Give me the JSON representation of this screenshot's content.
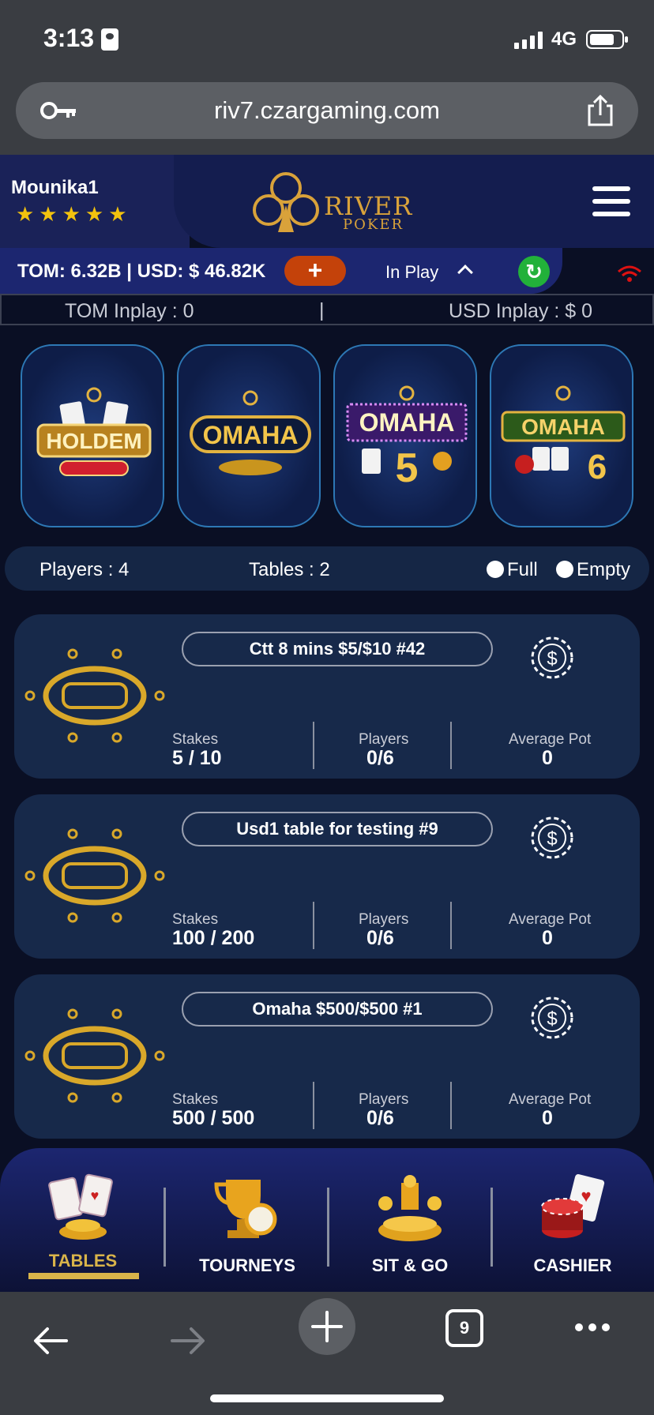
{
  "status_bar": {
    "time": "3:13",
    "network": "4G"
  },
  "browser": {
    "url": "riv7.czargaming.com",
    "tab_count": "9"
  },
  "header": {
    "username": "Mounika1",
    "stars": "★★★★★",
    "logo_text_1": "RIVER",
    "logo_text_2": "POKER",
    "balance": "TOM: 6.32B | USD: $ 46.82K",
    "add_label": "+",
    "inplay_label": "In Play",
    "refresh_label": "↻"
  },
  "inplay_bar": {
    "tom": "TOM Inplay : 0",
    "separator": "|",
    "usd": "USD Inplay : $ 0"
  },
  "game_types": [
    {
      "name": "HOLDEM"
    },
    {
      "name": "OMAHA"
    },
    {
      "name": "OMAHA",
      "number": "5"
    },
    {
      "name": "OMAHA",
      "number": "6"
    }
  ],
  "filter": {
    "players": "Players : 4",
    "tables": "Tables : 2",
    "full_label": "Full",
    "empty_label": "Empty"
  },
  "stat_labels": {
    "stakes": "Stakes",
    "players": "Players",
    "avg_pot": "Average Pot"
  },
  "tables": [
    {
      "name": "Ctt 8 mins $5/$10 #42",
      "stakes": "5 / 10",
      "players": "0/6",
      "avg_pot": "0"
    },
    {
      "name": "Usd1 table for testing #9",
      "stakes": "100 / 200",
      "players": "0/6",
      "avg_pot": "0"
    },
    {
      "name": "Omaha $500/$500 #1",
      "stakes": "500 / 500",
      "players": "0/6",
      "avg_pot": "0"
    }
  ],
  "app_nav": {
    "items": [
      {
        "label": "TABLES",
        "active": true
      },
      {
        "label": "TOURNEYS"
      },
      {
        "label": "SIT & GO"
      },
      {
        "label": "CASHIER"
      }
    ]
  },
  "colors": {
    "accent_gold": "#d9b44a",
    "add_button": "#c4420a",
    "refresh_button": "#22b13a",
    "card_bg": "#17294a"
  }
}
